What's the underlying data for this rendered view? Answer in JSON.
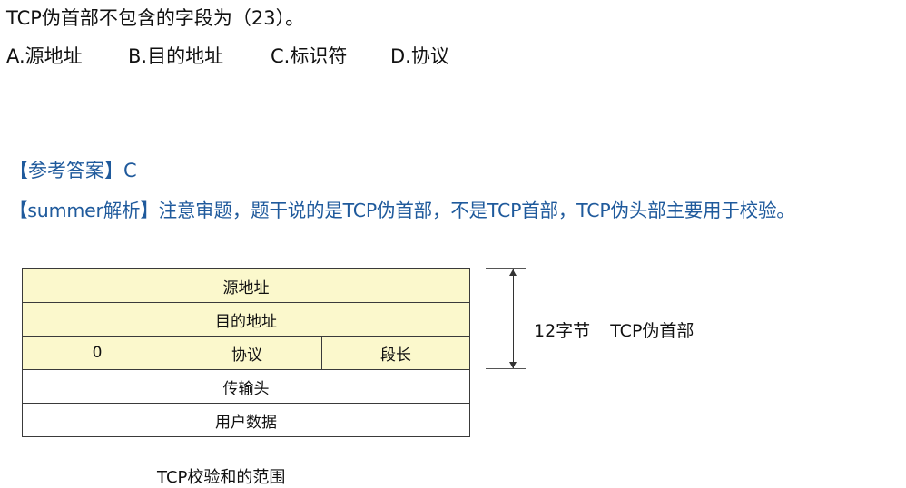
{
  "question": "TCP伪首部不包含的字段为（23）。",
  "options": {
    "a": "A.源地址",
    "b": "B.目的地址",
    "c": "C.标识符",
    "d": "D.协议"
  },
  "answer": "【参考答案】C",
  "analysis": "【summer解析】注意审题，题干说的是TCP伪首部，不是TCP首部，TCP伪头部主要用于校验。",
  "diagram": {
    "rows": {
      "source_address": "源地址",
      "dest_address": "目的地址",
      "zero": "0",
      "protocol": "协议",
      "segment_length": "段长",
      "transport_header": "传输头",
      "user_data": "用户数据"
    },
    "side_bytes": "12字节",
    "side_name": "TCP伪首部",
    "caption": "TCP校验和的范围",
    "colors": {
      "header_fill": "#fbf8cc",
      "answer_text": "#1f5a9c"
    }
  }
}
